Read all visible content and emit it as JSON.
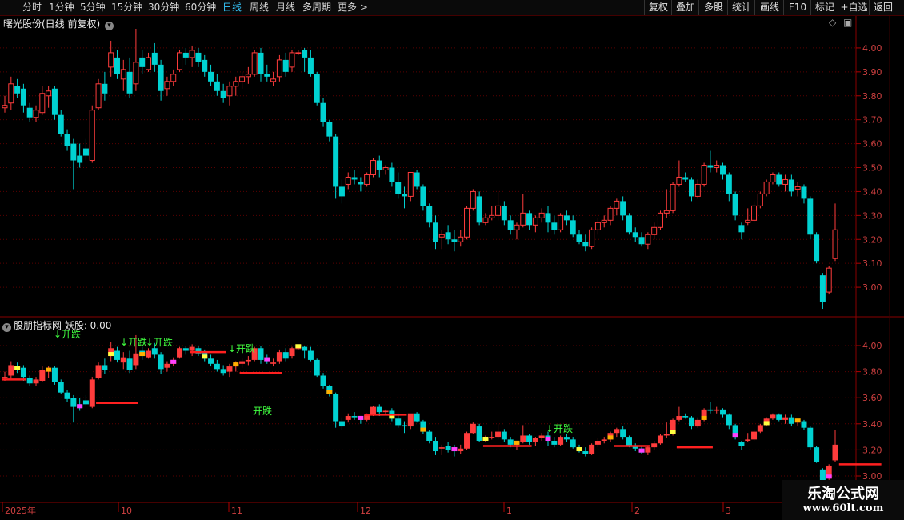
{
  "colors": {
    "up": "#ff3c3c",
    "down": "#00d2d2",
    "grid": "#5a0000",
    "axis_text": "#d04040",
    "signal": "#40ff40",
    "lowline": "#ff2020"
  },
  "toolbar": {
    "timeframes": [
      {
        "label": "分时"
      },
      {
        "label": "1分钟"
      },
      {
        "label": "5分钟"
      },
      {
        "label": "15分钟"
      },
      {
        "label": "30分钟"
      },
      {
        "label": "60分钟"
      },
      {
        "label": "日线",
        "active": true
      },
      {
        "label": "周线"
      },
      {
        "label": "月线"
      },
      {
        "label": "多周期"
      },
      {
        "label": "更多 >"
      }
    ],
    "right_buttons": [
      {
        "label": "复权"
      },
      {
        "label": "叠加"
      },
      {
        "label": "多股"
      },
      {
        "label": "统计"
      },
      {
        "label": "画线"
      },
      {
        "label": "F10"
      },
      {
        "label": "标记"
      },
      {
        "label": "+自选"
      },
      {
        "label": "返回"
      }
    ]
  },
  "main_panel": {
    "title": "曙光股份(日线 前复权)"
  },
  "indicator_panel": {
    "title": "股朋指标网 妖股: 0.00",
    "signal_label": "↓开跌",
    "signal_label_alt": "开跌"
  },
  "x_axis": {
    "labels": [
      "2025年",
      "10",
      "11",
      "12",
      "1",
      "2",
      "3"
    ]
  },
  "watermark": {
    "line1": "乐淘公式网",
    "line2": "www.60lt.com"
  },
  "chart_data": [
    {
      "type": "candlestick",
      "title": "曙光股份(日线 前复权)",
      "y_ticks": [
        4.0,
        3.9,
        3.8,
        3.7,
        3.6,
        3.5,
        3.4,
        3.3,
        3.2,
        3.1,
        3.0
      ],
      "ylim": [
        2.88,
        4.09
      ],
      "ohlc": [
        [
          3.75,
          3.8,
          3.73,
          3.76
        ],
        [
          3.77,
          3.88,
          3.74,
          3.85
        ],
        [
          3.84,
          3.87,
          3.79,
          3.81
        ],
        [
          3.83,
          3.85,
          3.73,
          3.76
        ],
        [
          3.75,
          3.77,
          3.69,
          3.71
        ],
        [
          3.71,
          3.76,
          3.69,
          3.74
        ],
        [
          3.73,
          3.84,
          3.72,
          3.81
        ],
        [
          3.8,
          3.84,
          3.75,
          3.82
        ],
        [
          3.83,
          3.84,
          3.7,
          3.72
        ],
        [
          3.72,
          3.74,
          3.63,
          3.64
        ],
        [
          3.64,
          3.66,
          3.57,
          3.59
        ],
        [
          3.6,
          3.62,
          3.41,
          3.53
        ],
        [
          3.55,
          3.6,
          3.5,
          3.52
        ],
        [
          3.58,
          3.62,
          3.53,
          3.55
        ],
        [
          3.53,
          3.76,
          3.52,
          3.74
        ],
        [
          3.75,
          3.87,
          3.74,
          3.85
        ],
        [
          3.85,
          3.9,
          3.78,
          3.81
        ],
        [
          3.92,
          4.03,
          3.88,
          3.98
        ],
        [
          3.96,
          3.99,
          3.87,
          3.89
        ],
        [
          3.87,
          3.95,
          3.82,
          3.91
        ],
        [
          3.9,
          3.96,
          3.79,
          3.81
        ],
        [
          3.85,
          4.08,
          3.82,
          3.94
        ],
        [
          3.96,
          3.99,
          3.89,
          3.92
        ],
        [
          3.91,
          3.98,
          3.9,
          3.96
        ],
        [
          3.98,
          4.02,
          3.9,
          3.93
        ],
        [
          3.93,
          3.95,
          3.78,
          3.82
        ],
        [
          3.83,
          3.88,
          3.8,
          3.86
        ],
        [
          3.86,
          3.91,
          3.84,
          3.89
        ],
        [
          3.91,
          3.99,
          3.9,
          3.98
        ],
        [
          3.98,
          4.0,
          3.93,
          3.96
        ],
        [
          3.96,
          4.01,
          3.92,
          3.99
        ],
        [
          3.98,
          4.0,
          3.92,
          3.94
        ],
        [
          3.95,
          3.97,
          3.88,
          3.9
        ],
        [
          3.9,
          3.93,
          3.84,
          3.86
        ],
        [
          3.86,
          3.89,
          3.8,
          3.82
        ],
        [
          3.82,
          3.85,
          3.77,
          3.79
        ],
        [
          3.8,
          3.86,
          3.76,
          3.84
        ],
        [
          3.84,
          3.88,
          3.8,
          3.86
        ],
        [
          3.86,
          3.9,
          3.83,
          3.88
        ],
        [
          3.88,
          3.92,
          3.85,
          3.89
        ],
        [
          3.89,
          3.99,
          3.88,
          3.98
        ],
        [
          3.98,
          4.0,
          3.86,
          3.89
        ],
        [
          3.89,
          3.93,
          3.86,
          3.88
        ],
        [
          3.86,
          3.9,
          3.84,
          3.87
        ],
        [
          3.88,
          3.97,
          3.86,
          3.95
        ],
        [
          3.95,
          3.98,
          3.88,
          3.9
        ],
        [
          3.92,
          3.99,
          3.9,
          3.98
        ],
        [
          3.98,
          3.99,
          3.97,
          3.98
        ],
        [
          3.99,
          4.0,
          3.9,
          3.96
        ],
        [
          3.96,
          3.99,
          3.88,
          3.89
        ],
        [
          3.89,
          3.9,
          3.76,
          3.77
        ],
        [
          3.77,
          3.79,
          3.67,
          3.69
        ],
        [
          3.69,
          3.7,
          3.61,
          3.63
        ],
        [
          3.63,
          3.64,
          3.37,
          3.42
        ],
        [
          3.42,
          3.45,
          3.35,
          3.38
        ],
        [
          3.43,
          3.48,
          3.41,
          3.46
        ],
        [
          3.46,
          3.49,
          3.43,
          3.45
        ],
        [
          3.44,
          3.46,
          3.4,
          3.43
        ],
        [
          3.43,
          3.48,
          3.42,
          3.47
        ],
        [
          3.47,
          3.54,
          3.46,
          3.53
        ],
        [
          3.53,
          3.55,
          3.46,
          3.49
        ],
        [
          3.49,
          3.51,
          3.47,
          3.5
        ],
        [
          3.5,
          3.52,
          3.42,
          3.44
        ],
        [
          3.44,
          3.48,
          3.37,
          3.39
        ],
        [
          3.39,
          3.42,
          3.33,
          3.38
        ],
        [
          3.38,
          3.46,
          3.36,
          3.48
        ],
        [
          3.48,
          3.49,
          3.41,
          3.42
        ],
        [
          3.42,
          3.43,
          3.32,
          3.34
        ],
        [
          3.34,
          3.35,
          3.25,
          3.27
        ],
        [
          3.27,
          3.3,
          3.16,
          3.19
        ],
        [
          3.21,
          3.24,
          3.16,
          3.22
        ],
        [
          3.23,
          3.26,
          3.18,
          3.2
        ],
        [
          3.2,
          3.24,
          3.15,
          3.19
        ],
        [
          3.19,
          3.24,
          3.17,
          3.21
        ],
        [
          3.21,
          3.34,
          3.2,
          3.33
        ],
        [
          3.33,
          3.41,
          3.32,
          3.4
        ],
        [
          3.38,
          3.4,
          3.26,
          3.27
        ],
        [
          3.27,
          3.31,
          3.26,
          3.29
        ],
        [
          3.29,
          3.34,
          3.28,
          3.3
        ],
        [
          3.3,
          3.4,
          3.28,
          3.34
        ],
        [
          3.34,
          3.36,
          3.26,
          3.28
        ],
        [
          3.28,
          3.3,
          3.22,
          3.24
        ],
        [
          3.24,
          3.27,
          3.2,
          3.26
        ],
        [
          3.26,
          3.39,
          3.25,
          3.31
        ],
        [
          3.31,
          3.32,
          3.24,
          3.26
        ],
        [
          3.26,
          3.3,
          3.23,
          3.29
        ],
        [
          3.29,
          3.33,
          3.27,
          3.31
        ],
        [
          3.31,
          3.34,
          3.23,
          3.27
        ],
        [
          3.27,
          3.3,
          3.22,
          3.24
        ],
        [
          3.24,
          3.31,
          3.23,
          3.3
        ],
        [
          3.3,
          3.32,
          3.26,
          3.28
        ],
        [
          3.28,
          3.3,
          3.21,
          3.22
        ],
        [
          3.22,
          3.24,
          3.18,
          3.19
        ],
        [
          3.19,
          3.22,
          3.15,
          3.17
        ],
        [
          3.17,
          3.25,
          3.16,
          3.24
        ],
        [
          3.24,
          3.29,
          3.22,
          3.27
        ],
        [
          3.27,
          3.3,
          3.25,
          3.28
        ],
        [
          3.28,
          3.34,
          3.26,
          3.33
        ],
        [
          3.33,
          3.37,
          3.3,
          3.36
        ],
        [
          3.36,
          3.38,
          3.28,
          3.3
        ],
        [
          3.3,
          3.31,
          3.22,
          3.23
        ],
        [
          3.23,
          3.25,
          3.19,
          3.21
        ],
        [
          3.21,
          3.23,
          3.17,
          3.18
        ],
        [
          3.18,
          3.23,
          3.16,
          3.22
        ],
        [
          3.22,
          3.27,
          3.2,
          3.25
        ],
        [
          3.25,
          3.32,
          3.24,
          3.31
        ],
        [
          3.31,
          3.41,
          3.29,
          3.32
        ],
        [
          3.32,
          3.44,
          3.31,
          3.43
        ],
        [
          3.43,
          3.53,
          3.42,
          3.46
        ],
        [
          3.46,
          3.48,
          3.44,
          3.45
        ],
        [
          3.45,
          3.46,
          3.36,
          3.38
        ],
        [
          3.38,
          3.45,
          3.37,
          3.43
        ],
        [
          3.43,
          3.52,
          3.42,
          3.51
        ],
        [
          3.51,
          3.57,
          3.48,
          3.5
        ],
        [
          3.5,
          3.53,
          3.48,
          3.51
        ],
        [
          3.51,
          3.52,
          3.45,
          3.47
        ],
        [
          3.47,
          3.48,
          3.36,
          3.39
        ],
        [
          3.39,
          3.4,
          3.28,
          3.3
        ],
        [
          3.26,
          3.27,
          3.2,
          3.23
        ],
        [
          3.27,
          3.33,
          3.26,
          3.28
        ],
        [
          3.28,
          3.36,
          3.27,
          3.34
        ],
        [
          3.34,
          3.4,
          3.33,
          3.39
        ],
        [
          3.39,
          3.45,
          3.38,
          3.44
        ],
        [
          3.44,
          3.48,
          3.43,
          3.47
        ],
        [
          3.47,
          3.48,
          3.42,
          3.43
        ],
        [
          3.43,
          3.47,
          3.4,
          3.45
        ],
        [
          3.45,
          3.47,
          3.38,
          3.4
        ],
        [
          3.41,
          3.44,
          3.38,
          3.42
        ],
        [
          3.42,
          3.43,
          3.35,
          3.37
        ],
        [
          3.37,
          3.38,
          3.2,
          3.22
        ],
        [
          3.22,
          3.23,
          3.1,
          3.11
        ],
        [
          3.05,
          3.06,
          2.91,
          2.94
        ],
        [
          2.98,
          3.09,
          2.97,
          3.08
        ],
        [
          3.12,
          3.35,
          3.11,
          3.24
        ]
      ]
    }
  ]
}
